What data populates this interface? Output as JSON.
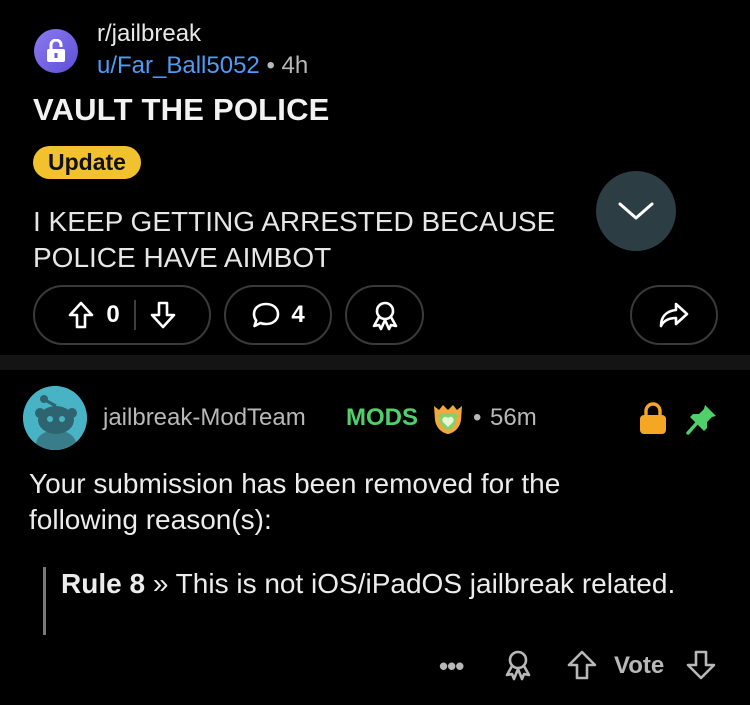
{
  "post": {
    "subreddit": "r/jailbreak",
    "author": "u/Far_Ball5052",
    "separator": "•",
    "age": "4h",
    "title": "VAULT THE POLICE",
    "flair": "Update",
    "body": "I KEEP GETTING ARRESTED BECAUSE POLICE HAVE AIMBOT",
    "vote_score": "0",
    "comment_count": "4"
  },
  "comment": {
    "author": "jailbreak-ModTeam",
    "mods_label": "MODS",
    "separator": "•",
    "age": "56m",
    "text": "Your submission has been removed for the following reason(s):",
    "rule_label": "Rule 8",
    "rule_sep": "»",
    "rule_text": "This is not iOS/iPadOS jailbreak related.",
    "more": "•••",
    "vote_label": "Vote"
  },
  "colors": {
    "background": "#000000",
    "username_blue": "#4d9cf5",
    "flair_yellow": "#f2c12e",
    "mods_green": "#4fd06a",
    "lock_orange": "#f5a623",
    "pin_green": "#4fd06a"
  },
  "icons": {
    "subreddit_avatar": "lock-icon",
    "collapse": "chevron-down-icon",
    "upvote": "arrow-up-icon",
    "downvote": "arrow-down-icon",
    "comments": "speech-bubble-icon",
    "award": "award-icon",
    "share": "share-icon",
    "mod_badge": "shield-icon",
    "locked": "lock-icon",
    "pinned": "pin-icon"
  }
}
